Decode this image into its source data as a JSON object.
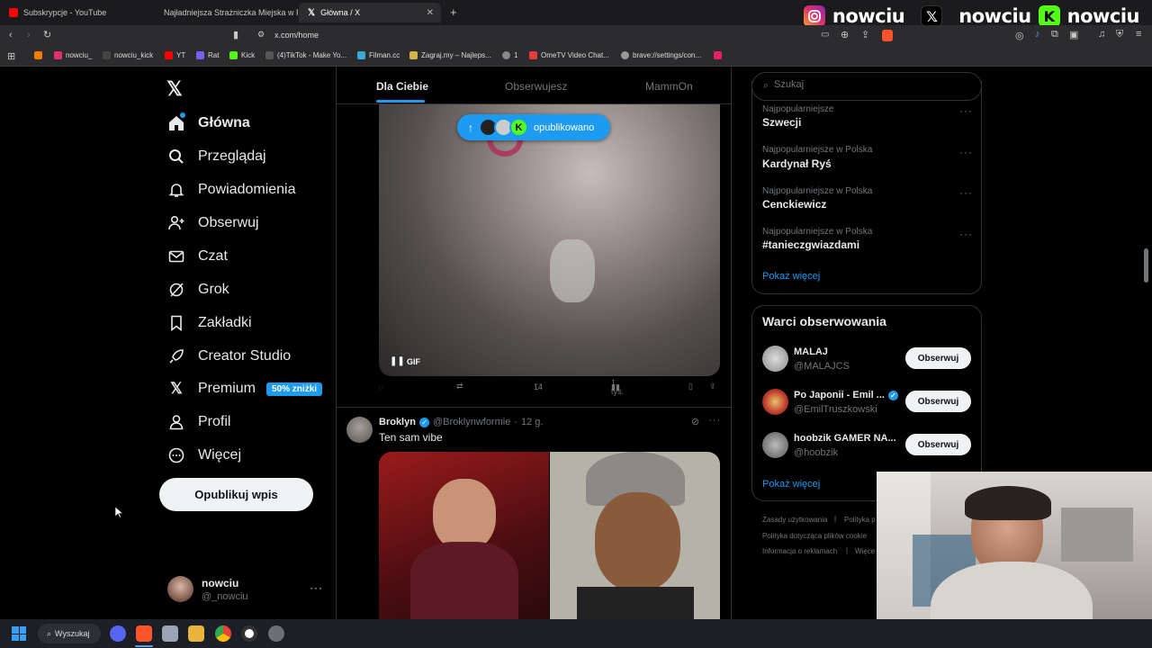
{
  "tabs": [
    {
      "title": "Subskrypcje - YouTube",
      "color": "#ff0000"
    },
    {
      "title": "Najładniejsza Strażniczka Miejska w P",
      "color": "#ff0000"
    },
    {
      "title": "Główna / X",
      "color": "#ffffff"
    }
  ],
  "address": {
    "url": "x.com/home"
  },
  "bookmarks": [
    {
      "label": "",
      "color": "#f57c00"
    },
    {
      "label": "nowciu_",
      "color": "#e1306c"
    },
    {
      "label": "nowciu_kick",
      "color": "#000000"
    },
    {
      "label": "YT",
      "color": "#ff0000"
    },
    {
      "label": "Rat",
      "color": "#7b5cff"
    },
    {
      "label": "Kick",
      "color": "#53fc18"
    },
    {
      "label": "(4)TikTok - Make Yo...",
      "color": "#111111"
    },
    {
      "label": "Filman.cc",
      "color": "#3ba9d6"
    },
    {
      "label": "Zagraj.my – Najleps...",
      "color": "#d4b24c"
    },
    {
      "label": "1",
      "color": "#888888"
    },
    {
      "label": "OmeTV Video Chat...",
      "color": "#e63b3b"
    },
    {
      "label": "brave://settings/con...",
      "color": "#999999"
    }
  ],
  "socials": [
    {
      "label": "nowciu_",
      "icon": "instagram-icon",
      "color": "#e1306c"
    },
    {
      "label": "_nowciu",
      "icon": "x-icon",
      "color": "#000000"
    },
    {
      "label": "nowciu",
      "icon": "kick-icon",
      "color": "#53fc18"
    }
  ],
  "nav": {
    "items": [
      {
        "label": "Główna",
        "icon": "home-icon"
      },
      {
        "label": "Przeglądaj",
        "icon": "search-icon"
      },
      {
        "label": "Powiadomienia",
        "icon": "bell-icon"
      },
      {
        "label": "Obserwuj",
        "icon": "person-add-icon"
      },
      {
        "label": "Czat",
        "icon": "mail-icon"
      },
      {
        "label": "Grok",
        "icon": "grok-icon"
      },
      {
        "label": "Zakładki",
        "icon": "bookmark-icon"
      },
      {
        "label": "Creator Studio",
        "icon": "rocket-icon"
      },
      {
        "label": "Premium",
        "icon": "x-icon"
      },
      {
        "label": "Profil",
        "icon": "person-icon"
      },
      {
        "label": "Więcej",
        "icon": "more-circle-icon"
      }
    ],
    "premium_badge": "50% zniżki",
    "post_button": "Opublikuj wpis",
    "account": {
      "name": "nowciu",
      "handle": "@_nowciu"
    }
  },
  "feed": {
    "tabs": [
      "Dla Ciebie",
      "Obserwujesz",
      "MammOn"
    ],
    "new_posts_pill": "opublikowano",
    "gif_badge": "GIF",
    "post1_stats": {
      "likes": "14",
      "views": "1 tys."
    },
    "post2": {
      "author": "Broklyn",
      "handle": "@Broklynwformie",
      "time": "12 g.",
      "text": "Ten sam vibe"
    }
  },
  "search": {
    "placeholder": "Szukaj"
  },
  "trends": [
    {
      "category": "Najpopularniejsze",
      "name": "Szwecji"
    },
    {
      "category": "Najpopularniejsze w Polska",
      "name": "Kardynał Ryś"
    },
    {
      "category": "Najpopularniejsze w Polska",
      "name": "Cenckiewicz"
    },
    {
      "category": "Najpopularniejsze w Polska",
      "name": "#tanieczgwiazdami"
    }
  ],
  "show_more": "Pokaż więcej",
  "who_to_follow": {
    "title": "Warci obserwowania",
    "users": [
      {
        "name": "MALAJ",
        "handle": "@MALAJCS",
        "verified": false
      },
      {
        "name": "Po Japonii - Emil ...",
        "handle": "@EmilTruszkowski",
        "verified": true
      },
      {
        "name": "hoobzik GAMER NA...",
        "handle": "@hoobzik",
        "verified": false
      }
    ],
    "follow_label": "Obserwuj",
    "show_more": "Pokaż więcej"
  },
  "footer": [
    "Zasady użytkowania",
    "Polityka p",
    "Polityka dotycząca plików cookie",
    "Informacja o reklamach",
    "Więce"
  ],
  "taskbar": {
    "search": "Wyszukaj"
  }
}
